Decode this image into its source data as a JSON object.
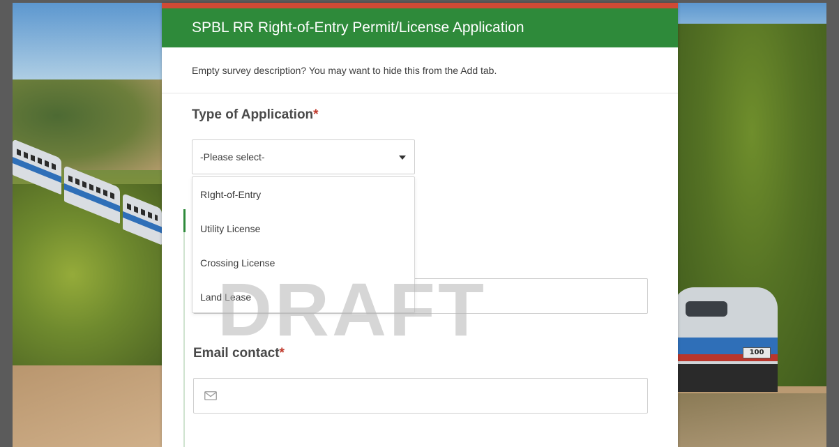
{
  "form": {
    "title": "SPBL RR Right-of-Entry Permit/License Application",
    "description": "Empty survey description? You may want to hide this from the Add tab."
  },
  "question1": {
    "label": "Type of Application",
    "required_marker": "*",
    "select": {
      "selected": "-Please select-",
      "options": [
        "RIght-of-Entry",
        "Utility License",
        "Crossing License",
        "Land Lease"
      ]
    }
  },
  "question2": {
    "label": "Email contact",
    "required_marker": "*"
  },
  "watermark": "DRAFT",
  "background": {
    "locomotive_number": "100"
  },
  "colors": {
    "header": "#2e8a3a",
    "top_accent": "#cf4a35",
    "required": "#c0392b"
  },
  "icons": {
    "select_caret": "caret-down-icon",
    "email": "envelope-icon"
  }
}
